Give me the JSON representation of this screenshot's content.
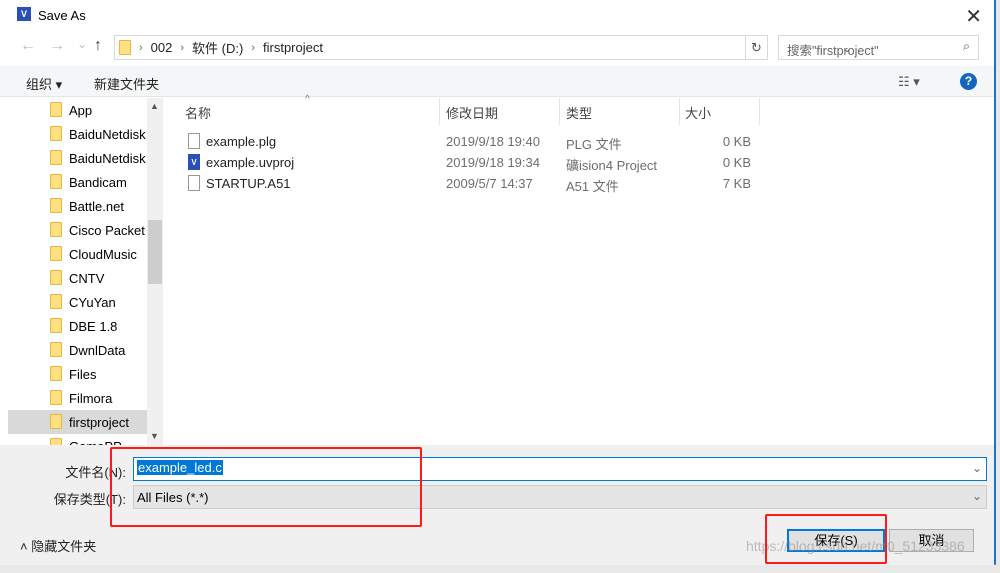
{
  "window": {
    "title": "Save As",
    "app_icon": "uvision-icon",
    "close": "✕"
  },
  "nav": {
    "back": "←",
    "forward": "→",
    "recent": "⌄",
    "up": "↑",
    "breadcrumb": [
      "002",
      "软件 (D:)",
      "firstproject"
    ],
    "refresh": "↻",
    "search_placeholder": "搜索\"firstproject\"",
    "search_icon": "⌕"
  },
  "toolbar": {
    "organize": "组织 ▾",
    "new_folder": "新建文件夹",
    "view": "☷ ▾",
    "help": "?"
  },
  "sidebar": {
    "items": [
      "App",
      "BaiduNetdisk",
      "BaiduNetdisk",
      "Bandicam",
      "Battle.net",
      "Cisco Packet T",
      "CloudMusic",
      "CNTV",
      "CYuYan",
      "DBE 1.8",
      "DwnlData",
      "Files",
      "Filmora",
      "firstproject",
      "GamePP"
    ],
    "selected": "firstproject",
    "scroll_up": "▲",
    "scroll_down": "▼"
  },
  "columns": {
    "name": "名称",
    "date": "修改日期",
    "type": "类型",
    "size": "大小",
    "sort": "^"
  },
  "files": [
    {
      "name": "example.plg",
      "date": "2019/9/18 19:40",
      "type": "PLG 文件",
      "size": "0 KB",
      "icon": "file-icon"
    },
    {
      "name": "example.uvproj",
      "date": "2019/9/18 19:34",
      "type": "礦ision4 Project",
      "size": "0 KB",
      "icon": "uvision-icon"
    },
    {
      "name": "STARTUP.A51",
      "date": "2009/5/7 14:37",
      "type": "A51 文件",
      "size": "7 KB",
      "icon": "file-icon"
    }
  ],
  "form": {
    "filename_label": "文件名(N):",
    "filename_value": "example_led.c",
    "type_label": "保存类型(T):",
    "type_value": "All Files (*.*)",
    "dropdown": "⌄"
  },
  "buttons": {
    "save": "保存(S)",
    "cancel": "取消",
    "hide_folders": "˄  隐藏文件夹"
  },
  "watermark": "https://blog.csdn.net/m0_51233386",
  "colors": {
    "accent": "#0078d7",
    "highlight": "#ff1a1a"
  }
}
